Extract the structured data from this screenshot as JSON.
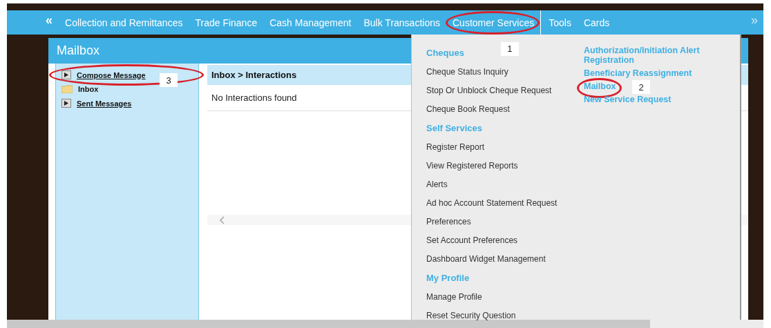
{
  "nav": {
    "prev": "«",
    "next": "»",
    "items": [
      {
        "label": "Collection and Remittances",
        "circled": false
      },
      {
        "label": "Trade Finance",
        "circled": false
      },
      {
        "label": "Cash Management",
        "circled": false
      },
      {
        "label": "Bulk Transactions",
        "circled": false
      },
      {
        "label": "Customer Services",
        "circled": true,
        "callout": "1"
      },
      {
        "label": "Tools",
        "circled": false
      },
      {
        "label": "Cards",
        "circled": false
      }
    ]
  },
  "mailbox": {
    "title": "Mailbox",
    "sidebar": [
      {
        "kind": "action",
        "label": "Compose Message",
        "circled": true,
        "callout": "3"
      },
      {
        "kind": "folder",
        "label": "Inbox",
        "circled": false
      },
      {
        "kind": "action",
        "label": "Sent Messages",
        "circled": false
      }
    ],
    "breadcrumb": "Inbox > Interactions",
    "message": "No Interactions found"
  },
  "dropdown": {
    "columns": [
      [
        {
          "kind": "heading",
          "text": "Cheques",
          "circled": false
        },
        {
          "kind": "item",
          "text": "Cheque Status Inquiry",
          "circled": false
        },
        {
          "kind": "item",
          "text": "Stop Or Unblock Cheque Request",
          "circled": false
        },
        {
          "kind": "item",
          "text": "Cheque Book Request",
          "circled": false
        },
        {
          "kind": "heading",
          "text": "Self Services",
          "circled": false
        },
        {
          "kind": "item",
          "text": "Register Report",
          "circled": false
        },
        {
          "kind": "item",
          "text": "View Registered Reports",
          "circled": false
        },
        {
          "kind": "item",
          "text": "Alerts",
          "circled": false
        },
        {
          "kind": "item",
          "text": "Ad hoc Account Statement Request",
          "circled": false
        },
        {
          "kind": "item",
          "text": "Preferences",
          "circled": false
        },
        {
          "kind": "item",
          "text": "Set Account Preferences",
          "circled": false
        },
        {
          "kind": "item",
          "text": "Dashboard Widget Management",
          "circled": false
        },
        {
          "kind": "heading",
          "text": "My Profile",
          "circled": false
        },
        {
          "kind": "item",
          "text": "Manage Profile",
          "circled": false
        },
        {
          "kind": "item",
          "text": "Reset Security Question",
          "circled": false
        }
      ],
      [
        {
          "kind": "link",
          "text": "Authorization/Initiation Alert Registration",
          "circled": false
        },
        {
          "kind": "link",
          "text": "Beneficiary Reassignment",
          "circled": false
        },
        {
          "kind": "link",
          "text": "Mailbox",
          "circled": true,
          "callout": "2"
        },
        {
          "kind": "link",
          "text": "New Service Request",
          "circled": false
        }
      ]
    ]
  }
}
